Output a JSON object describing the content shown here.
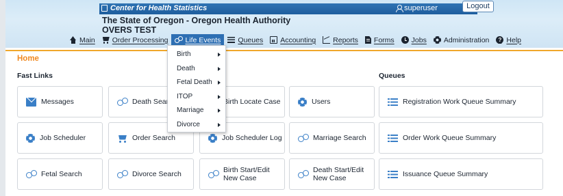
{
  "header": {
    "site_title": "Center for Health Statistics",
    "username": "superuser",
    "logout_label": "Logout",
    "org_name": "The State of Oregon - Oregon Health Authority",
    "environment": "OVERS TEST"
  },
  "nav": {
    "items": [
      {
        "label": "Main",
        "icon": "home-icon"
      },
      {
        "label": "Order Processing",
        "icon": "cart-icon"
      },
      {
        "label": "Life Events",
        "icon": "gender-icon",
        "active": true
      },
      {
        "label": "Queues",
        "icon": "list-icon"
      },
      {
        "label": "Accounting",
        "icon": "calculator-icon"
      },
      {
        "label": "Reports",
        "icon": "chart-icon"
      },
      {
        "label": "Forms",
        "icon": "document-icon"
      },
      {
        "label": "Jobs",
        "icon": "clock-icon"
      },
      {
        "label": "Administration",
        "icon": "gear-icon"
      },
      {
        "label": "Help",
        "icon": "help-icon"
      }
    ]
  },
  "life_events_menu": {
    "items": [
      "Birth",
      "Death",
      "Fetal Death",
      "ITOP",
      "Marriage",
      "Divorce"
    ]
  },
  "breadcrumb": {
    "home": "Home"
  },
  "sections": {
    "fast_links": "Fast Links",
    "queues": "Queues"
  },
  "tiles": {
    "messages": "Messages",
    "death_search": "Death Search",
    "birth_locate_case": "Birth Locate Case",
    "users": "Users",
    "registration_queue": "Registration Work Queue Summary",
    "job_scheduler": "Job Scheduler",
    "order_search": "Order Search",
    "job_scheduler_log": "Job Scheduler Log",
    "marriage_search": "Marriage Search",
    "order_queue": "Order Work Queue Summary",
    "fetal_search": "Fetal Search",
    "divorce_search": "Divorce Search",
    "birth_start_edit": "Birth Start/Edit New Case",
    "death_start_edit": "Death Start/Edit New Case",
    "issuance_queue": "Issuance Queue Summary"
  },
  "colors": {
    "brand_blue": "#2e6fb3",
    "accent_orange": "#f08a24",
    "icon_blue": "#3a7fc7"
  }
}
